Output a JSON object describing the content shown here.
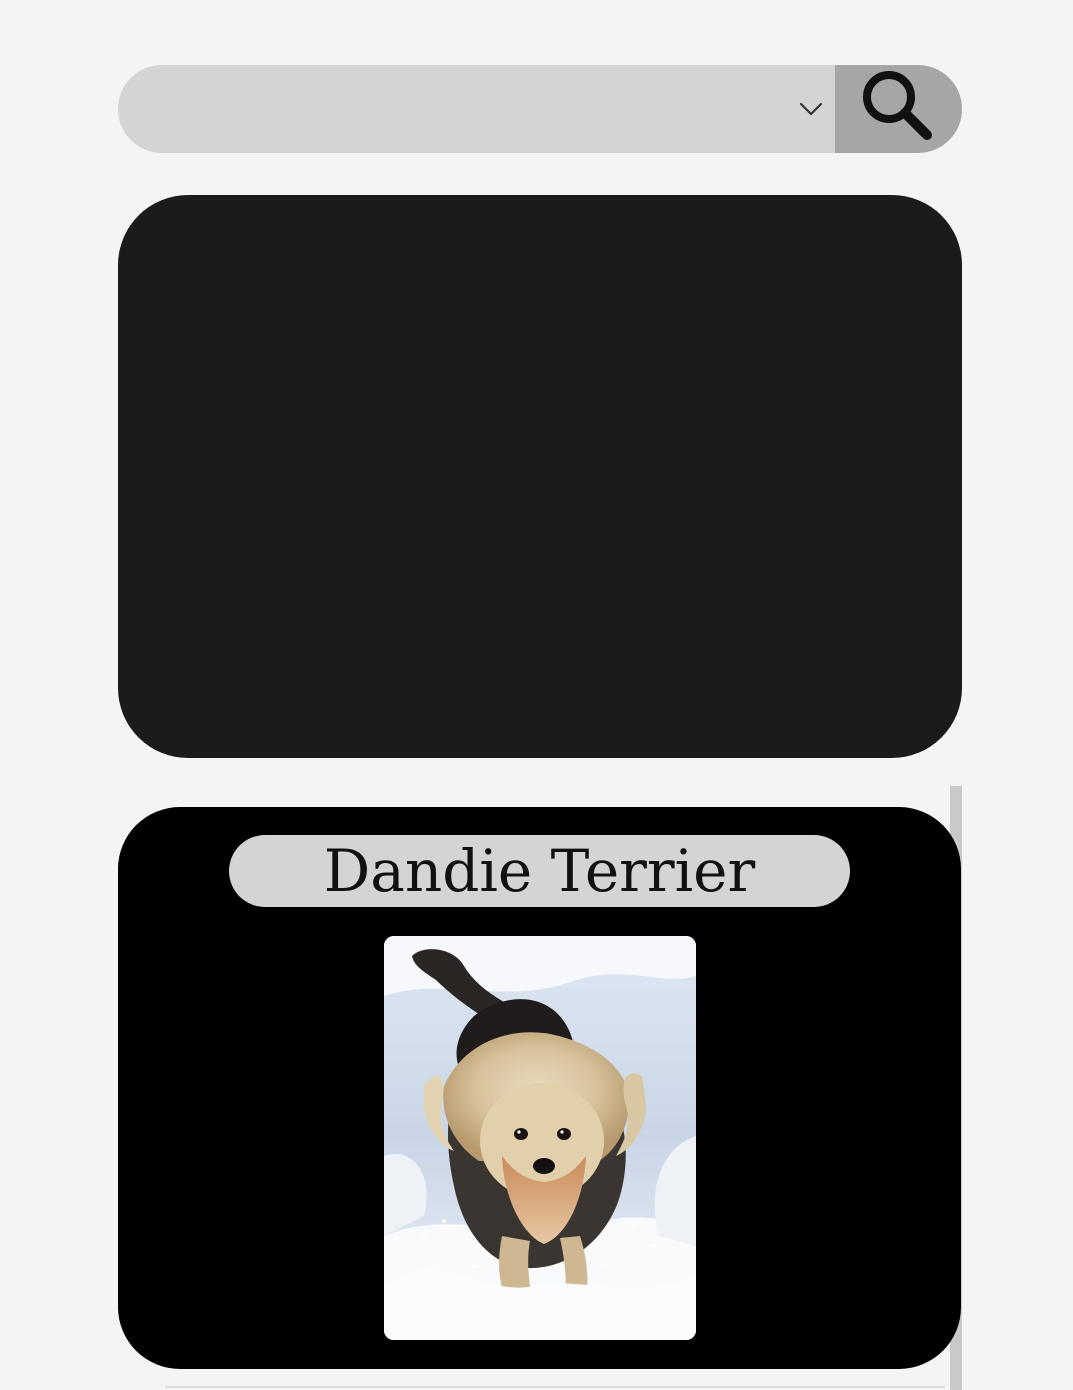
{
  "search": {
    "selected_value": "",
    "dropdown_icon": "chevron-down-icon",
    "button_icon": "search-icon"
  },
  "breed_card": {
    "title": "Dandie Terrier",
    "image_subject": "dandie-dinmont-terrier-photo"
  },
  "colors": {
    "page_background": "#f4f4f4",
    "search_field": "#d4d4d4",
    "search_button": "#a6a6a6",
    "dark_panel": "#1b1b1c",
    "card_background": "#000000",
    "title_pill": "#d4d4d4"
  }
}
